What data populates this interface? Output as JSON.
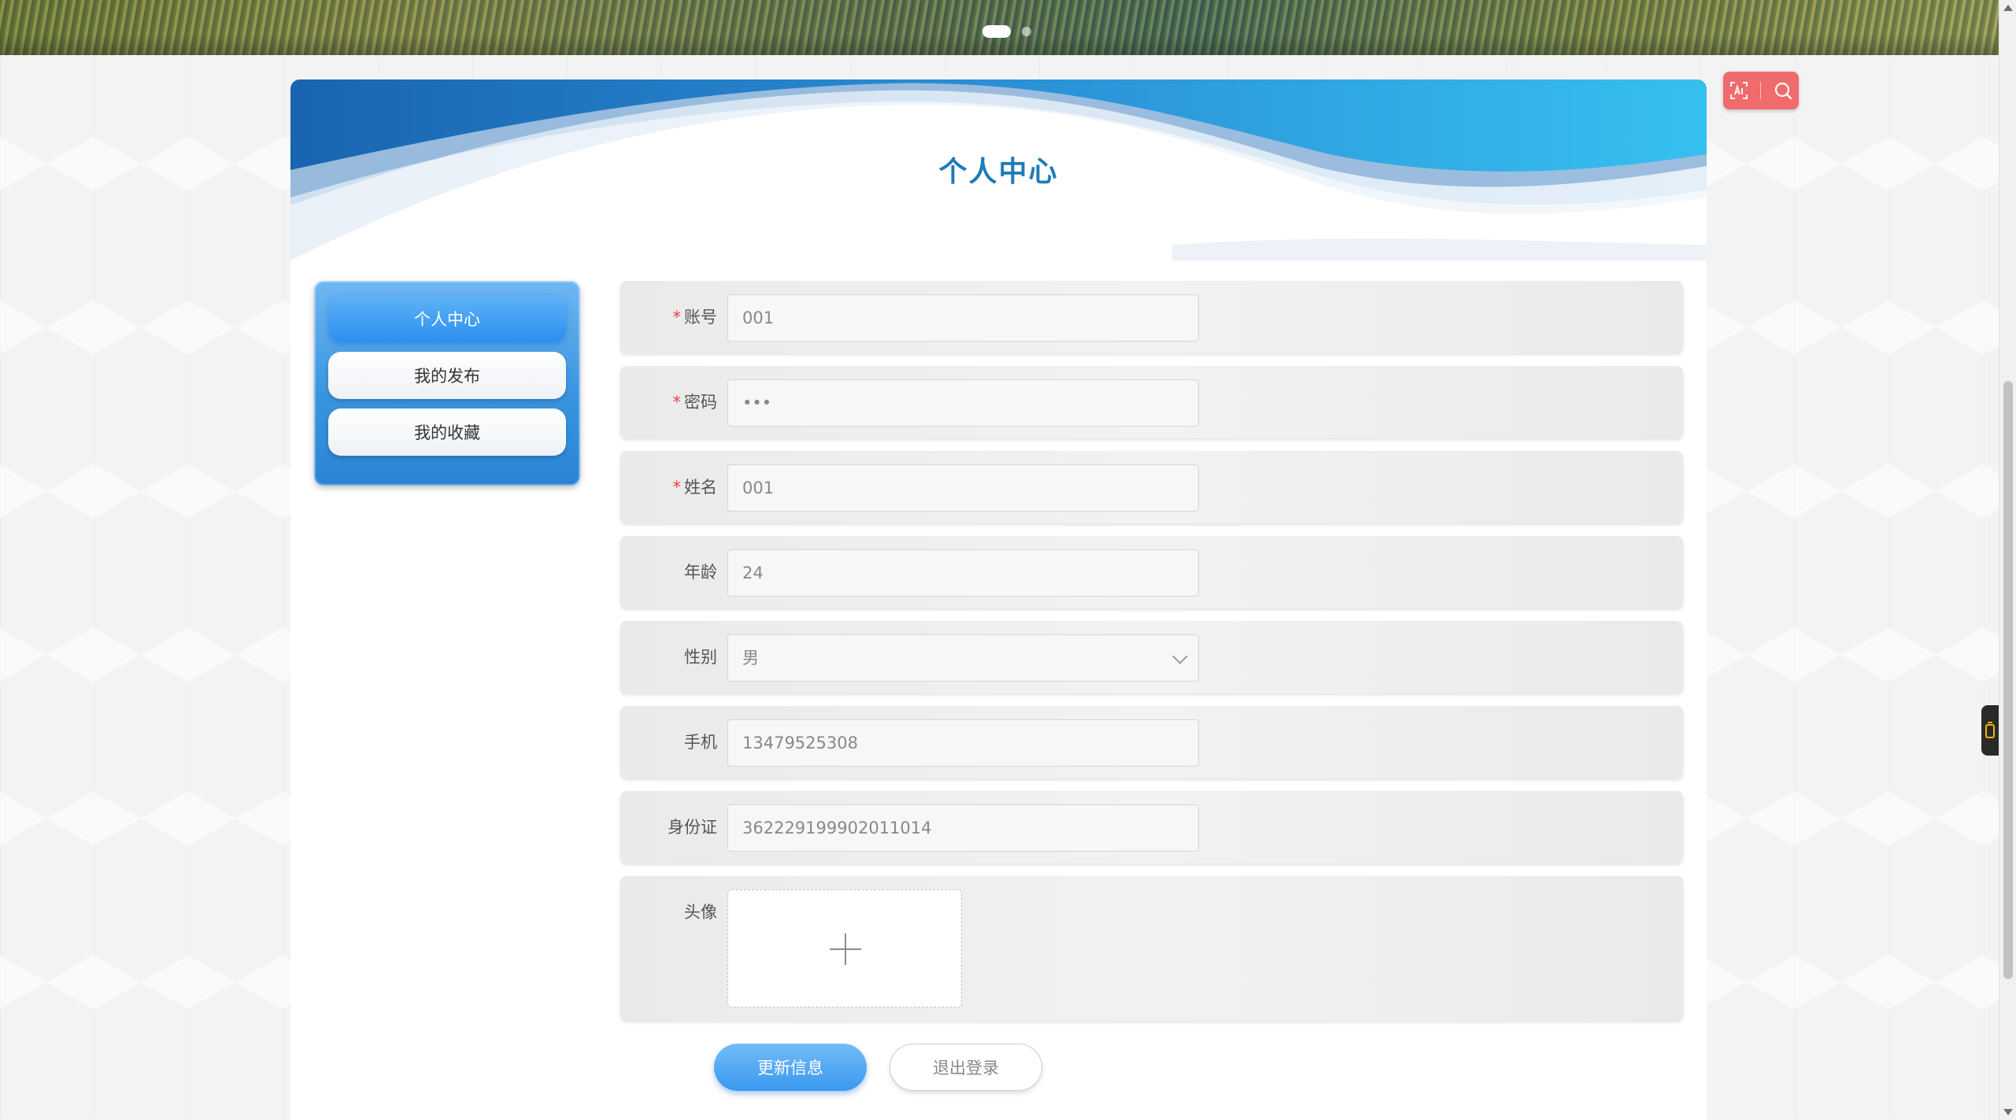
{
  "banner": {
    "slide_count": 2,
    "active_slide": 1
  },
  "header": {
    "title": "个人中心"
  },
  "menu": {
    "items": [
      {
        "label": "个人中心",
        "active": true
      },
      {
        "label": "我的发布",
        "active": false
      },
      {
        "label": "我的收藏",
        "active": false
      }
    ]
  },
  "form": {
    "account": {
      "label": "账号",
      "required": true,
      "value": "001"
    },
    "password": {
      "label": "密码",
      "required": true,
      "value": "•••"
    },
    "name": {
      "label": "姓名",
      "required": true,
      "value": "001"
    },
    "age": {
      "label": "年龄",
      "required": false,
      "value": "24"
    },
    "gender": {
      "label": "性别",
      "required": false,
      "value": "男"
    },
    "phone": {
      "label": "手机",
      "required": false,
      "value": "13479525308"
    },
    "id_card": {
      "label": "身份证",
      "required": false,
      "value": "362229199902011014"
    },
    "avatar": {
      "label": "头像",
      "required": false
    }
  },
  "actions": {
    "update_label": "更新信息",
    "logout_label": "退出登录"
  },
  "tools": {
    "icons": [
      "text-recognition-icon",
      "search-icon"
    ],
    "color": "#f06b6b"
  },
  "colors": {
    "accent": "#2b8fef",
    "title": "#1d7bb8",
    "required": "#e94343"
  }
}
